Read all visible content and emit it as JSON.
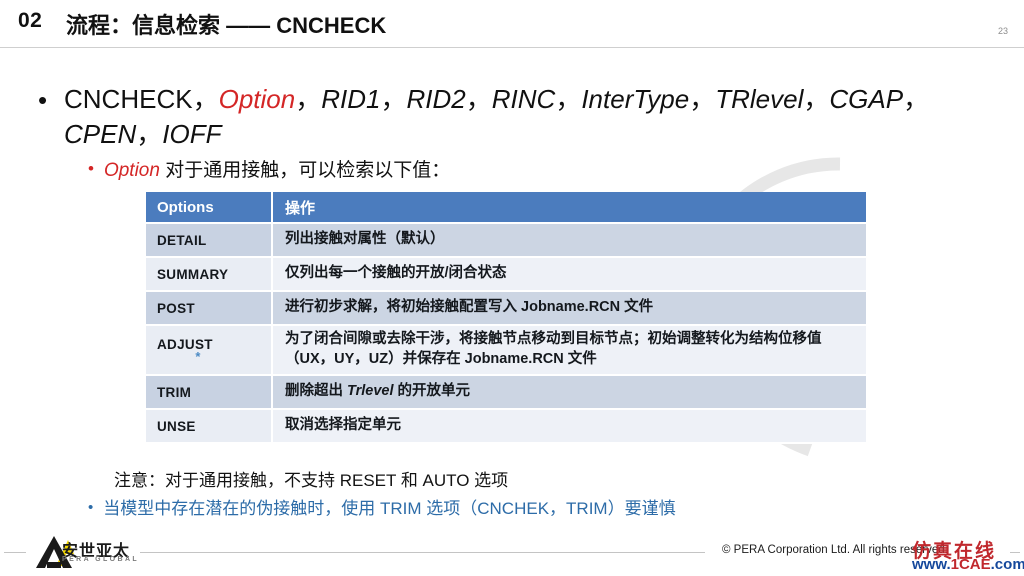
{
  "header": {
    "number": "02",
    "title": "流程：信息检索 —— CNCHECK",
    "page_number": "23"
  },
  "body": {
    "bullet1": {
      "marker": "•",
      "command": "CNCHECK",
      "params": [
        "Option",
        "RID1",
        "RID2",
        "RINC",
        "InterType",
        "TRlevel",
        "CGAP",
        "CPEN",
        "IOFF"
      ],
      "highlight_param": "Option",
      "separator": "，"
    },
    "bullet2": {
      "marker": "•",
      "lead": "Option",
      "text": " 对于通用接触，可以检索以下值："
    }
  },
  "table": {
    "headers": [
      "Options",
      "操作"
    ],
    "rows": [
      {
        "option": "DETAIL",
        "note": "",
        "desc": "列出接触对属性（默认）"
      },
      {
        "option": "SUMMARY",
        "note": "",
        "desc": "仅列出每一个接触的开放/闭合状态"
      },
      {
        "option": "POST",
        "note": "",
        "desc": "进行初步求解，将初始接触配置写入 Jobname.RCN 文件"
      },
      {
        "option": "ADJUST",
        "note": "*",
        "desc": "为了闭合间隙或去除干涉，将接触节点移动到目标节点；初始调整转化为结构位移值（UX，UY，UZ）并保存在 Jobname.RCN 文件"
      },
      {
        "option": "TRIM",
        "note": "",
        "desc_pre": "删除超出 ",
        "desc_italic": "Trlevel",
        "desc_post": " 的开放单元"
      },
      {
        "option": "UNSE",
        "note": "",
        "desc": "取消选择指定单元"
      }
    ]
  },
  "notes": {
    "note_plain": "注意：对于通用接触，不支持 RESET 和 AUTO 选项",
    "note_blue_marker": "•",
    "note_blue": "当模型中存在潜在的伪接触时，使用 TRIM 选项（CNCHEK，TRIM）要谨慎"
  },
  "footer": {
    "logo_cn": "安世亚太",
    "logo_en": "PERA GLOBAL",
    "copyright": "© PERA Corporation Ltd. All rights reserved.",
    "watermark_cn": "仿真在线",
    "watermark_url_prefix": "www.",
    "watermark_url_brand": "1CAE",
    "watermark_url_suffix": ".com"
  },
  "colors": {
    "table_header_bg": "#4b7cbe",
    "row_dark": "#ccd5e3",
    "row_light": "#eef1f7",
    "accent_red": "#d42626",
    "accent_blue": "#2d6ca8",
    "logo_yellow": "#f5d800"
  }
}
